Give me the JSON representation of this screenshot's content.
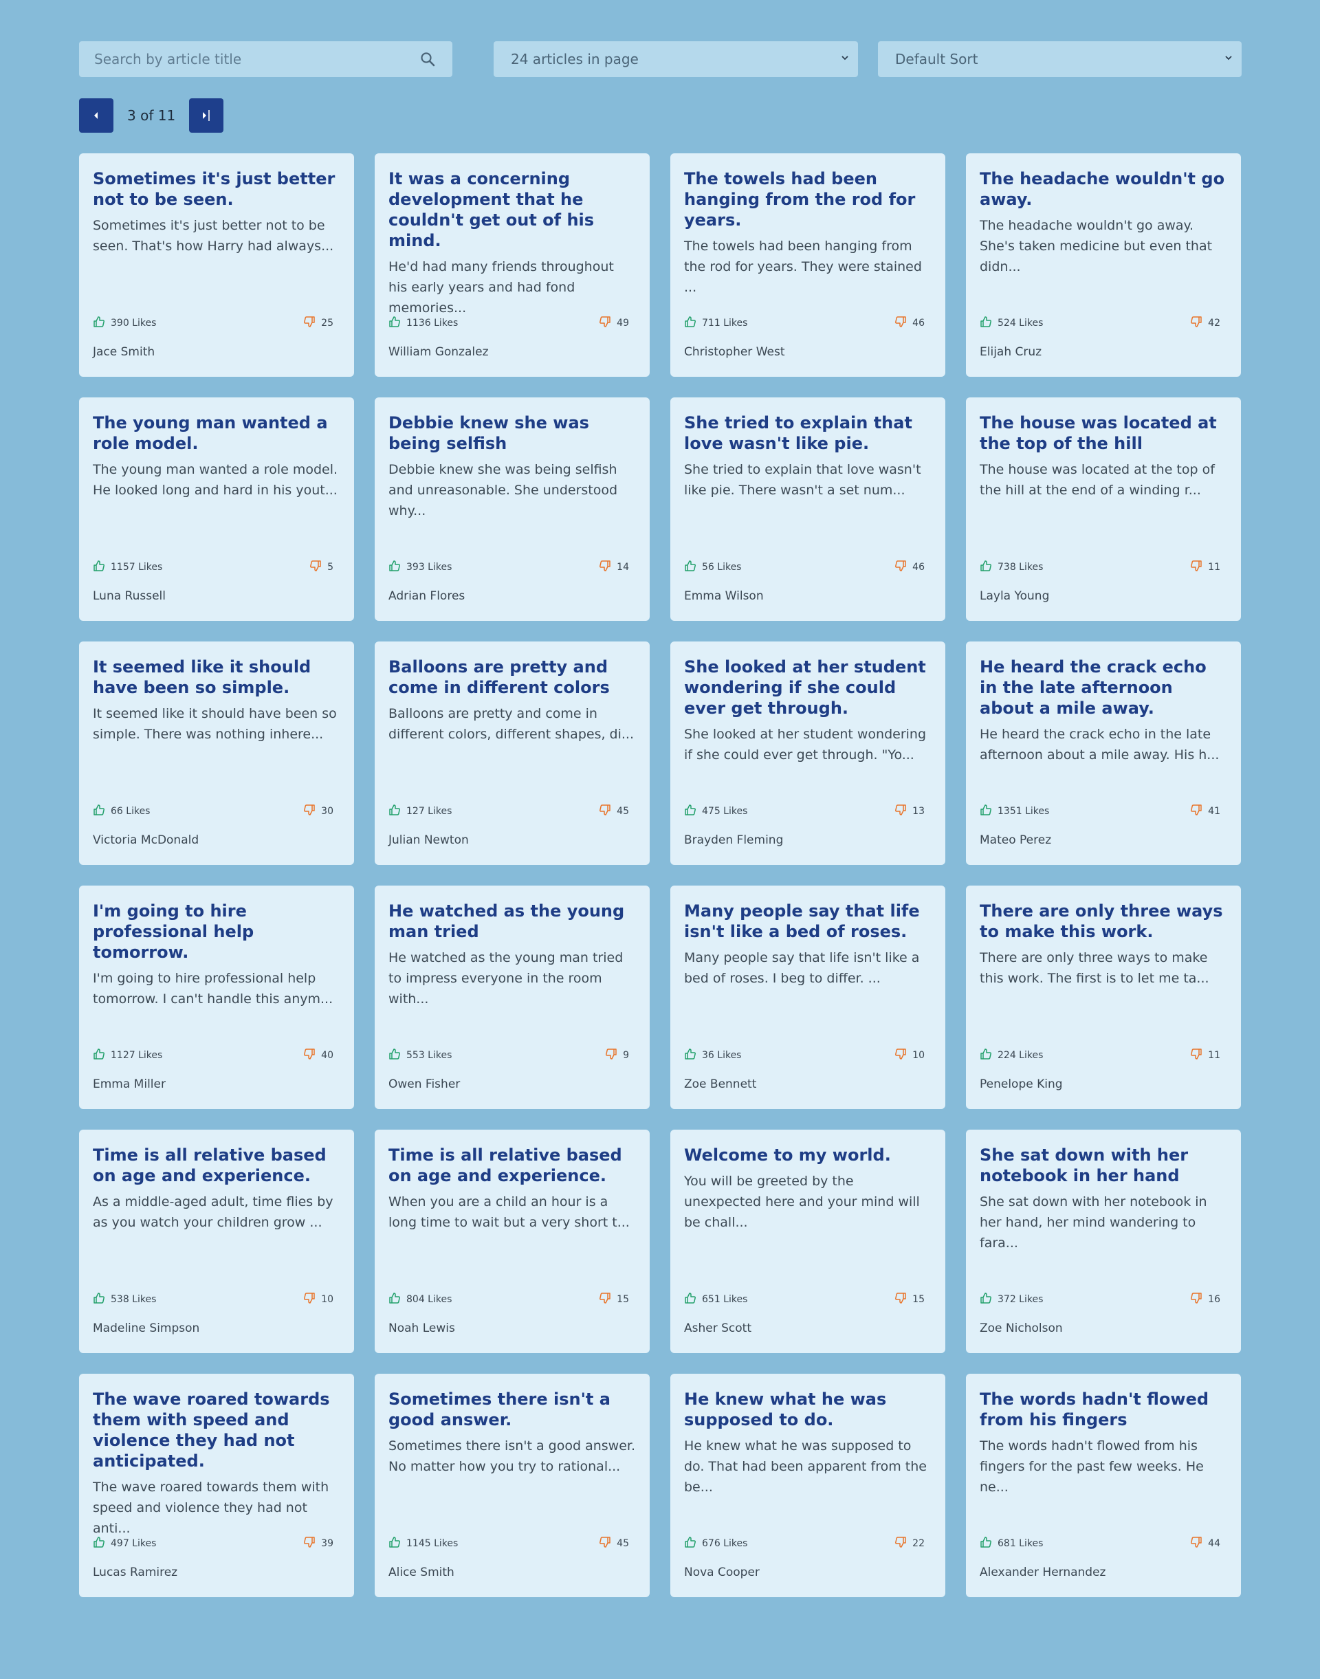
{
  "toolbar": {
    "search_placeholder": "Search by article title",
    "per_page": "24 articles in page",
    "sort": "Default Sort"
  },
  "pagination": {
    "text": "3 of 11"
  },
  "colors": {
    "like": "#22a06b",
    "dislike": "#e8742a",
    "accent": "#1e3f8c",
    "title": "#1e3d85"
  },
  "icons": {
    "search": "search-icon",
    "prev": "caret-left-icon",
    "next": "caret-right-icon",
    "like": "thumbs-up-icon",
    "dislike": "thumbs-down-icon"
  },
  "articles": [
    {
      "title": "Sometimes it's just better not to be seen.",
      "excerpt": "Sometimes it's just better not to be seen. That's how Harry had always...",
      "likes": "390 Likes",
      "dislikes": "25",
      "author": "Jace Smith"
    },
    {
      "title": "It was a concerning development that he couldn't get out of his mind.",
      "excerpt": "He'd had many friends throughout his early years and had fond memories...",
      "likes": "1136 Likes",
      "dislikes": "49",
      "author": "William Gonzalez"
    },
    {
      "title": "The towels had been hanging from the rod for years.",
      "excerpt": "The towels had been hanging from the rod for years. They were stained ...",
      "likes": "711 Likes",
      "dislikes": "46",
      "author": "Christopher West"
    },
    {
      "title": "The headache wouldn't go away.",
      "excerpt": "The headache wouldn't go away. She's taken medicine but even that didn...",
      "likes": "524 Likes",
      "dislikes": "42",
      "author": "Elijah Cruz"
    },
    {
      "title": "The young man wanted a role model.",
      "excerpt": "The young man wanted a role model. He looked long and hard in his yout...",
      "likes": "1157 Likes",
      "dislikes": "5",
      "author": "Luna Russell"
    },
    {
      "title": "Debbie knew she was being selfish",
      "excerpt": "Debbie knew she was being selfish and unreasonable. She understood why...",
      "likes": "393 Likes",
      "dislikes": "14",
      "author": "Adrian Flores"
    },
    {
      "title": "She tried to explain that love wasn't like pie.",
      "excerpt": "She tried to explain that love wasn't like pie. There wasn't a set num...",
      "likes": "56 Likes",
      "dislikes": "46",
      "author": "Emma Wilson"
    },
    {
      "title": "The house was located at the top of the hill",
      "excerpt": "The house was located at the top of the hill at the end of a winding r...",
      "likes": "738 Likes",
      "dislikes": "11",
      "author": "Layla Young"
    },
    {
      "title": "It seemed like it should have been so simple.",
      "excerpt": "It seemed like it should have been so simple. There was nothing inhere...",
      "likes": "66 Likes",
      "dislikes": "30",
      "author": "Victoria McDonald"
    },
    {
      "title": "Balloons are pretty and come in different colors",
      "excerpt": "Balloons are pretty and come in different colors, different shapes, di...",
      "likes": "127 Likes",
      "dislikes": "45",
      "author": "Julian Newton"
    },
    {
      "title": "She looked at her student wondering if she could ever get through.",
      "excerpt": "She looked at her student wondering if she could ever get through. \"Yo...",
      "likes": "475 Likes",
      "dislikes": "13",
      "author": "Brayden Fleming"
    },
    {
      "title": "He heard the crack echo in the late afternoon about a mile away.",
      "excerpt": "He heard the crack echo in the late afternoon about a mile away. His h...",
      "likes": "1351 Likes",
      "dislikes": "41",
      "author": "Mateo Perez"
    },
    {
      "title": "I'm going to hire professional help tomorrow.",
      "excerpt": "I'm going to hire professional help tomorrow. I can't handle this anym...",
      "likes": "1127 Likes",
      "dislikes": "40",
      "author": "Emma Miller"
    },
    {
      "title": "He watched as the young man tried",
      "excerpt": "He watched as the young man tried to impress everyone in the room with...",
      "likes": "553 Likes",
      "dislikes": "9",
      "author": "Owen Fisher"
    },
    {
      "title": "Many people say that life isn't like a bed of roses.",
      "excerpt": "Many people say that life isn't like a bed of roses. I beg to differ. ...",
      "likes": "36 Likes",
      "dislikes": "10",
      "author": "Zoe Bennett"
    },
    {
      "title": "There are only three ways to make this work.",
      "excerpt": "There are only three ways to make this work. The first is to let me ta...",
      "likes": "224 Likes",
      "dislikes": "11",
      "author": "Penelope King"
    },
    {
      "title": "Time is all relative based on age and experience.",
      "excerpt": "As a middle-aged adult, time flies by as you watch your children grow ...",
      "likes": "538 Likes",
      "dislikes": "10",
      "author": "Madeline Simpson"
    },
    {
      "title": "Time is all relative based on age and experience.",
      "excerpt": "When you are a child an hour is a long time to wait but a very short t...",
      "likes": "804 Likes",
      "dislikes": "15",
      "author": "Noah Lewis"
    },
    {
      "title": "Welcome to my world.",
      "excerpt": "You will be greeted by the unexpected here and your mind will be chall...",
      "likes": "651 Likes",
      "dislikes": "15",
      "author": "Asher Scott"
    },
    {
      "title": "She sat down with her notebook in her hand",
      "excerpt": "She sat down with her notebook in her hand, her mind wandering to fara...",
      "likes": "372 Likes",
      "dislikes": "16",
      "author": "Zoe Nicholson"
    },
    {
      "title": "The wave roared towards them with speed and violence they had not anticipated.",
      "excerpt": "The wave roared towards them with speed and violence they had not anti...",
      "likes": "497 Likes",
      "dislikes": "39",
      "author": "Lucas Ramirez"
    },
    {
      "title": "Sometimes there isn't a good answer.",
      "excerpt": "Sometimes there isn't a good answer. No matter how you try to rational...",
      "likes": "1145 Likes",
      "dislikes": "45",
      "author": "Alice Smith"
    },
    {
      "title": "He knew what he was supposed to do.",
      "excerpt": "He knew what he was supposed to do. That had been apparent from the be...",
      "likes": "676 Likes",
      "dislikes": "22",
      "author": "Nova Cooper"
    },
    {
      "title": "The words hadn't flowed from his fingers",
      "excerpt": "The words hadn't flowed from his fingers for the past few weeks. He ne...",
      "likes": "681 Likes",
      "dislikes": "44",
      "author": "Alexander Hernandez"
    }
  ]
}
